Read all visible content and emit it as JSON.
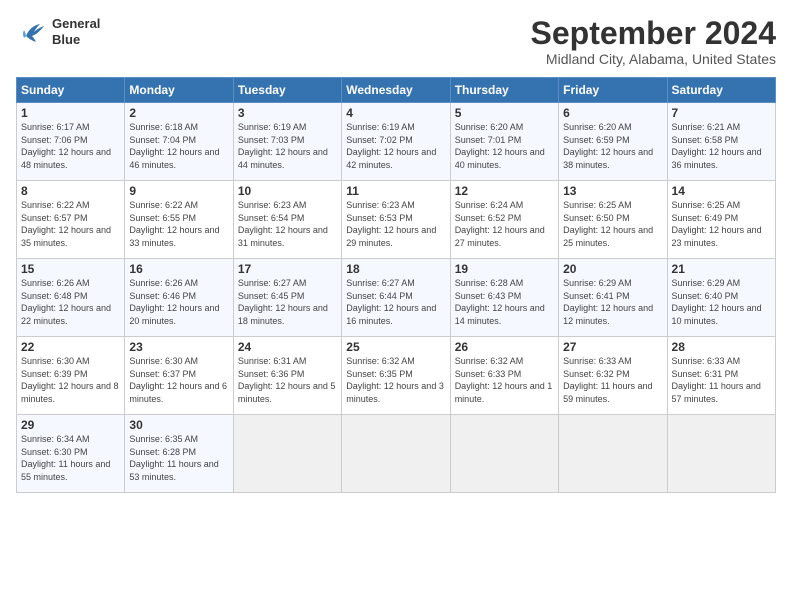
{
  "logo": {
    "line1": "General",
    "line2": "Blue"
  },
  "title": "September 2024",
  "location": "Midland City, Alabama, United States",
  "days_of_week": [
    "Sunday",
    "Monday",
    "Tuesday",
    "Wednesday",
    "Thursday",
    "Friday",
    "Saturday"
  ],
  "weeks": [
    [
      {
        "day": "1",
        "sunrise": "Sunrise: 6:17 AM",
        "sunset": "Sunset: 7:06 PM",
        "daylight": "Daylight: 12 hours and 48 minutes."
      },
      {
        "day": "2",
        "sunrise": "Sunrise: 6:18 AM",
        "sunset": "Sunset: 7:04 PM",
        "daylight": "Daylight: 12 hours and 46 minutes."
      },
      {
        "day": "3",
        "sunrise": "Sunrise: 6:19 AM",
        "sunset": "Sunset: 7:03 PM",
        "daylight": "Daylight: 12 hours and 44 minutes."
      },
      {
        "day": "4",
        "sunrise": "Sunrise: 6:19 AM",
        "sunset": "Sunset: 7:02 PM",
        "daylight": "Daylight: 12 hours and 42 minutes."
      },
      {
        "day": "5",
        "sunrise": "Sunrise: 6:20 AM",
        "sunset": "Sunset: 7:01 PM",
        "daylight": "Daylight: 12 hours and 40 minutes."
      },
      {
        "day": "6",
        "sunrise": "Sunrise: 6:20 AM",
        "sunset": "Sunset: 6:59 PM",
        "daylight": "Daylight: 12 hours and 38 minutes."
      },
      {
        "day": "7",
        "sunrise": "Sunrise: 6:21 AM",
        "sunset": "Sunset: 6:58 PM",
        "daylight": "Daylight: 12 hours and 36 minutes."
      }
    ],
    [
      {
        "day": "8",
        "sunrise": "Sunrise: 6:22 AM",
        "sunset": "Sunset: 6:57 PM",
        "daylight": "Daylight: 12 hours and 35 minutes."
      },
      {
        "day": "9",
        "sunrise": "Sunrise: 6:22 AM",
        "sunset": "Sunset: 6:55 PM",
        "daylight": "Daylight: 12 hours and 33 minutes."
      },
      {
        "day": "10",
        "sunrise": "Sunrise: 6:23 AM",
        "sunset": "Sunset: 6:54 PM",
        "daylight": "Daylight: 12 hours and 31 minutes."
      },
      {
        "day": "11",
        "sunrise": "Sunrise: 6:23 AM",
        "sunset": "Sunset: 6:53 PM",
        "daylight": "Daylight: 12 hours and 29 minutes."
      },
      {
        "day": "12",
        "sunrise": "Sunrise: 6:24 AM",
        "sunset": "Sunset: 6:52 PM",
        "daylight": "Daylight: 12 hours and 27 minutes."
      },
      {
        "day": "13",
        "sunrise": "Sunrise: 6:25 AM",
        "sunset": "Sunset: 6:50 PM",
        "daylight": "Daylight: 12 hours and 25 minutes."
      },
      {
        "day": "14",
        "sunrise": "Sunrise: 6:25 AM",
        "sunset": "Sunset: 6:49 PM",
        "daylight": "Daylight: 12 hours and 23 minutes."
      }
    ],
    [
      {
        "day": "15",
        "sunrise": "Sunrise: 6:26 AM",
        "sunset": "Sunset: 6:48 PM",
        "daylight": "Daylight: 12 hours and 22 minutes."
      },
      {
        "day": "16",
        "sunrise": "Sunrise: 6:26 AM",
        "sunset": "Sunset: 6:46 PM",
        "daylight": "Daylight: 12 hours and 20 minutes."
      },
      {
        "day": "17",
        "sunrise": "Sunrise: 6:27 AM",
        "sunset": "Sunset: 6:45 PM",
        "daylight": "Daylight: 12 hours and 18 minutes."
      },
      {
        "day": "18",
        "sunrise": "Sunrise: 6:27 AM",
        "sunset": "Sunset: 6:44 PM",
        "daylight": "Daylight: 12 hours and 16 minutes."
      },
      {
        "day": "19",
        "sunrise": "Sunrise: 6:28 AM",
        "sunset": "Sunset: 6:43 PM",
        "daylight": "Daylight: 12 hours and 14 minutes."
      },
      {
        "day": "20",
        "sunrise": "Sunrise: 6:29 AM",
        "sunset": "Sunset: 6:41 PM",
        "daylight": "Daylight: 12 hours and 12 minutes."
      },
      {
        "day": "21",
        "sunrise": "Sunrise: 6:29 AM",
        "sunset": "Sunset: 6:40 PM",
        "daylight": "Daylight: 12 hours and 10 minutes."
      }
    ],
    [
      {
        "day": "22",
        "sunrise": "Sunrise: 6:30 AM",
        "sunset": "Sunset: 6:39 PM",
        "daylight": "Daylight: 12 hours and 8 minutes."
      },
      {
        "day": "23",
        "sunrise": "Sunrise: 6:30 AM",
        "sunset": "Sunset: 6:37 PM",
        "daylight": "Daylight: 12 hours and 6 minutes."
      },
      {
        "day": "24",
        "sunrise": "Sunrise: 6:31 AM",
        "sunset": "Sunset: 6:36 PM",
        "daylight": "Daylight: 12 hours and 5 minutes."
      },
      {
        "day": "25",
        "sunrise": "Sunrise: 6:32 AM",
        "sunset": "Sunset: 6:35 PM",
        "daylight": "Daylight: 12 hours and 3 minutes."
      },
      {
        "day": "26",
        "sunrise": "Sunrise: 6:32 AM",
        "sunset": "Sunset: 6:33 PM",
        "daylight": "Daylight: 12 hours and 1 minute."
      },
      {
        "day": "27",
        "sunrise": "Sunrise: 6:33 AM",
        "sunset": "Sunset: 6:32 PM",
        "daylight": "Daylight: 11 hours and 59 minutes."
      },
      {
        "day": "28",
        "sunrise": "Sunrise: 6:33 AM",
        "sunset": "Sunset: 6:31 PM",
        "daylight": "Daylight: 11 hours and 57 minutes."
      }
    ],
    [
      {
        "day": "29",
        "sunrise": "Sunrise: 6:34 AM",
        "sunset": "Sunset: 6:30 PM",
        "daylight": "Daylight: 11 hours and 55 minutes."
      },
      {
        "day": "30",
        "sunrise": "Sunrise: 6:35 AM",
        "sunset": "Sunset: 6:28 PM",
        "daylight": "Daylight: 11 hours and 53 minutes."
      },
      null,
      null,
      null,
      null,
      null
    ]
  ]
}
